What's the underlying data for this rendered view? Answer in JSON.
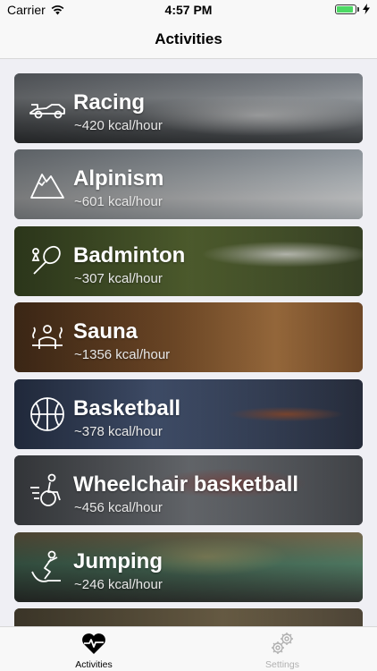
{
  "status": {
    "carrier": "Carrier",
    "time": "4:57 PM"
  },
  "nav": {
    "title": "Activities"
  },
  "activities": [
    {
      "name": "Racing",
      "kcal": "~420 kcal/hour",
      "icon": "race-car-icon"
    },
    {
      "name": "Alpinism",
      "kcal": "~601 kcal/hour",
      "icon": "mountain-icon"
    },
    {
      "name": "Badminton",
      "kcal": "~307 kcal/hour",
      "icon": "badminton-icon"
    },
    {
      "name": "Sauna",
      "kcal": "~1356 kcal/hour",
      "icon": "sauna-icon"
    },
    {
      "name": "Basketball",
      "kcal": "~378 kcal/hour",
      "icon": "basketball-icon"
    },
    {
      "name": "Wheelchair basketball",
      "kcal": "~456 kcal/hour",
      "icon": "wheelchair-icon"
    },
    {
      "name": "Jumping",
      "kcal": "~246 kcal/hour",
      "icon": "trampoline-icon"
    }
  ],
  "tabs": [
    {
      "label": "Activities",
      "icon": "heart-pulse-icon",
      "active": true
    },
    {
      "label": "Settings",
      "icon": "gears-icon",
      "active": false
    }
  ],
  "colors": {
    "battery": "#4cd964",
    "tab_active": "#000000",
    "tab_inactive": "#b0b0b0"
  }
}
